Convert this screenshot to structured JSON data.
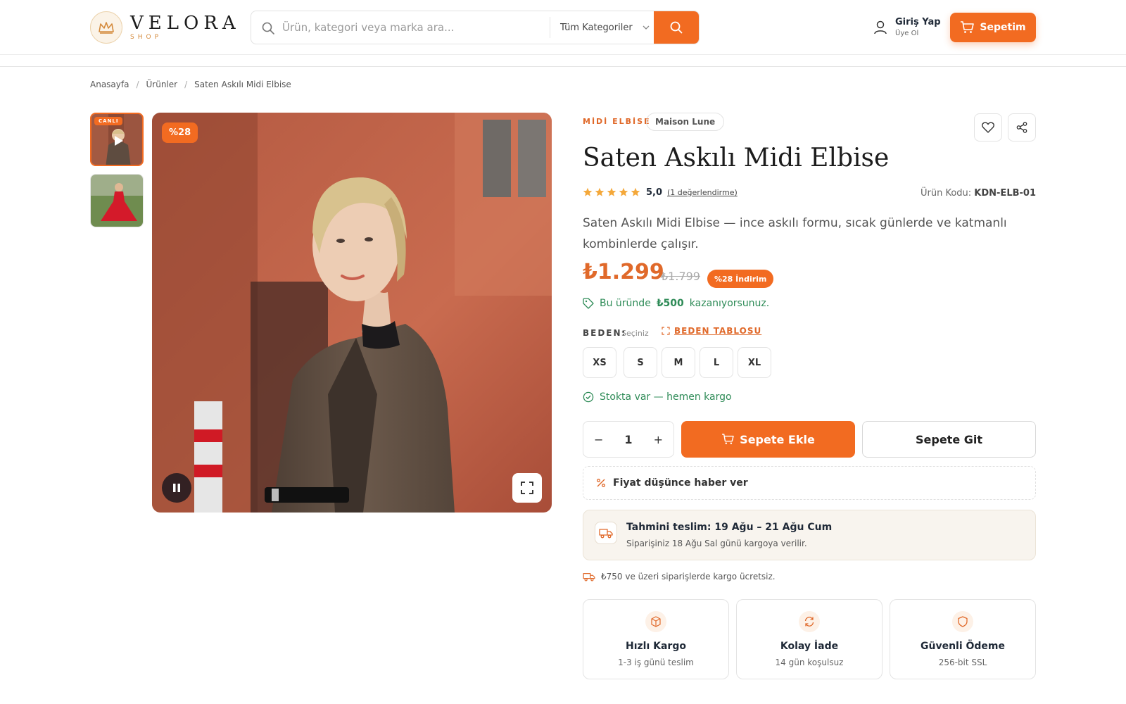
{
  "header": {
    "logo_word": "VELORA",
    "logo_sub": "SHOP",
    "search_placeholder": "Ürün, kategori veya marka ara...",
    "category_select": "Tüm Kategoriler",
    "login_title": "Giriş Yap",
    "login_sub": "Üye Ol",
    "cart_label": "Sepetim"
  },
  "breadcrumb": {
    "items": [
      "Anasayfa",
      "Ürünler",
      "Saten Askılı Midi Elbise"
    ],
    "separator": "/"
  },
  "gallery": {
    "live_badge": "CANLI",
    "discount_badge": "%28"
  },
  "product": {
    "category": "MİDİ ELBİSE",
    "brand": "Maison Lune",
    "title": "Saten Askılı Midi Elbise",
    "rating_value": "5,0",
    "rating_stars": 5,
    "rating_count": "(1 değerlendirme)",
    "sku_label": "Ürün Kodu:",
    "sku_value": "KDN-ELB-01",
    "description": "Saten Askılı Midi Elbise — ince askılı formu, sıcak günlerde ve katmanlı kombinlerde çalışır.",
    "price": "₺1.299",
    "old_price": "₺1.799",
    "discount_label": "%28 İndirim",
    "earn_prefix": "Bu üründe",
    "earn_amount": "₺500",
    "earn_suffix": "kazanıyorsunuz.",
    "size_label": "BEDEN:",
    "size_hint": "Seçiniz",
    "size_chart": "BEDEN TABLOSU",
    "sizes": [
      "XS",
      "S",
      "M",
      "L",
      "XL"
    ],
    "stock_text": "Stokta var — hemen kargo",
    "qty_minus": "−",
    "qty_value": "1",
    "qty_plus": "+",
    "add_to_cart": "Sepete Ekle",
    "go_to_cart": "Sepete Git",
    "price_alert": "Fiyat düşünce haber ver"
  },
  "delivery": {
    "title": "Tahmini teslim: 19 Ağu – 21 Ağu Cum",
    "subtitle": "Siparişiniz 18 Ağu Sal günü kargoya verilir."
  },
  "shipping_note": "₺750 ve üzeri siparişlerde kargo ücretsiz.",
  "features": [
    {
      "title": "Hızlı Kargo",
      "subtitle": "1-3 iş günü teslim",
      "icon": "box-icon"
    },
    {
      "title": "Kolay İade",
      "subtitle": "14 gün koşulsuz",
      "icon": "refresh-icon"
    },
    {
      "title": "Güvenli Ödeme",
      "subtitle": "256-bit SSL",
      "icon": "shield-icon"
    }
  ],
  "colors": {
    "accent": "#f26b21",
    "accent_text": "#e0692a",
    "success": "#2e8b57",
    "star": "#f4a83a"
  }
}
